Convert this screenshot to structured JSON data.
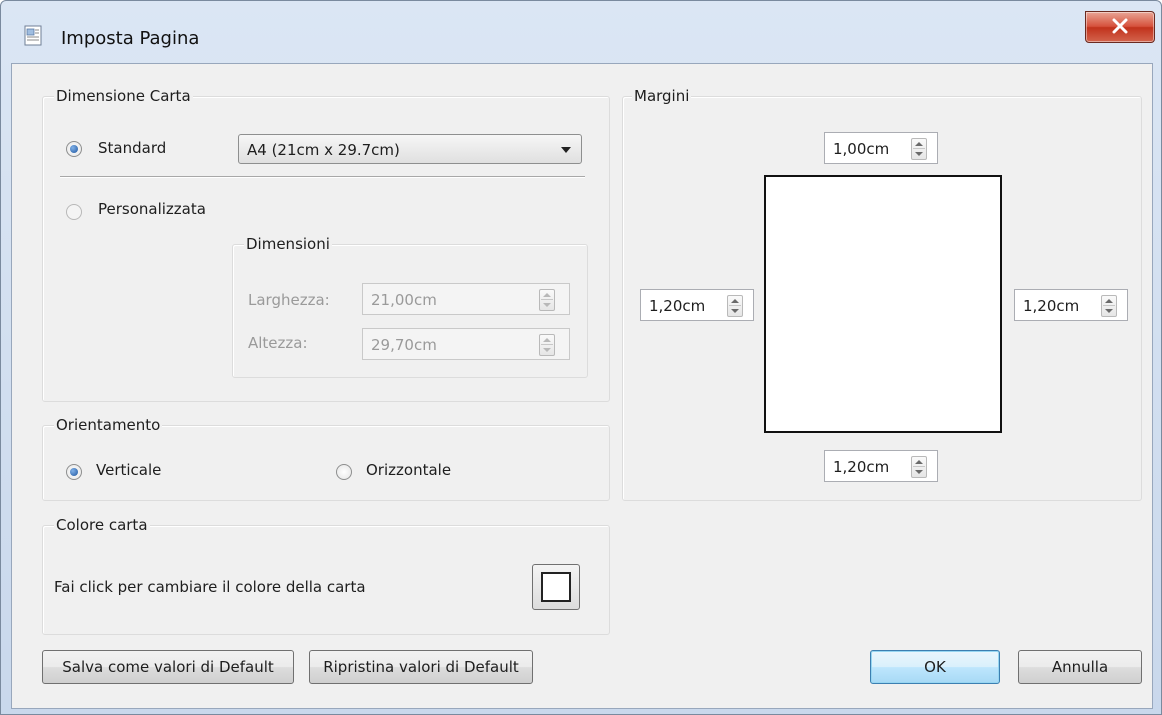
{
  "window": {
    "title": "Imposta Pagina"
  },
  "paper_size": {
    "legend": "Dimensione Carta",
    "standard_label": "Standard",
    "standard_selected": true,
    "standard_value": "A4 (21cm x 29.7cm)",
    "custom_label": "Personalizzata",
    "custom_selected": false,
    "dimensions": {
      "legend": "Dimensioni",
      "width_label": "Larghezza:",
      "width_value": "21,00cm",
      "height_label": "Altezza:",
      "height_value": "29,70cm"
    }
  },
  "orientation": {
    "legend": "Orientamento",
    "portrait_label": "Verticale",
    "portrait_selected": true,
    "landscape_label": "Orizzontale",
    "landscape_selected": false
  },
  "paper_color": {
    "legend": "Colore carta",
    "description": "Fai click per cambiare il colore della carta",
    "color": "#ffffff"
  },
  "margins": {
    "legend": "Margini",
    "top": "1,00cm",
    "left": "1,20cm",
    "right": "1,20cm",
    "bottom": "1,20cm"
  },
  "buttons": {
    "save_default": "Salva come valori di Default",
    "restore_default": "Ripristina valori di Default",
    "ok": "OK",
    "cancel": "Annulla"
  },
  "icons": {
    "app": "page-setup-icon",
    "close": "close-icon"
  },
  "colors": {
    "close_button": "#c7422c",
    "ok_button_border": "#3c7fb1"
  }
}
